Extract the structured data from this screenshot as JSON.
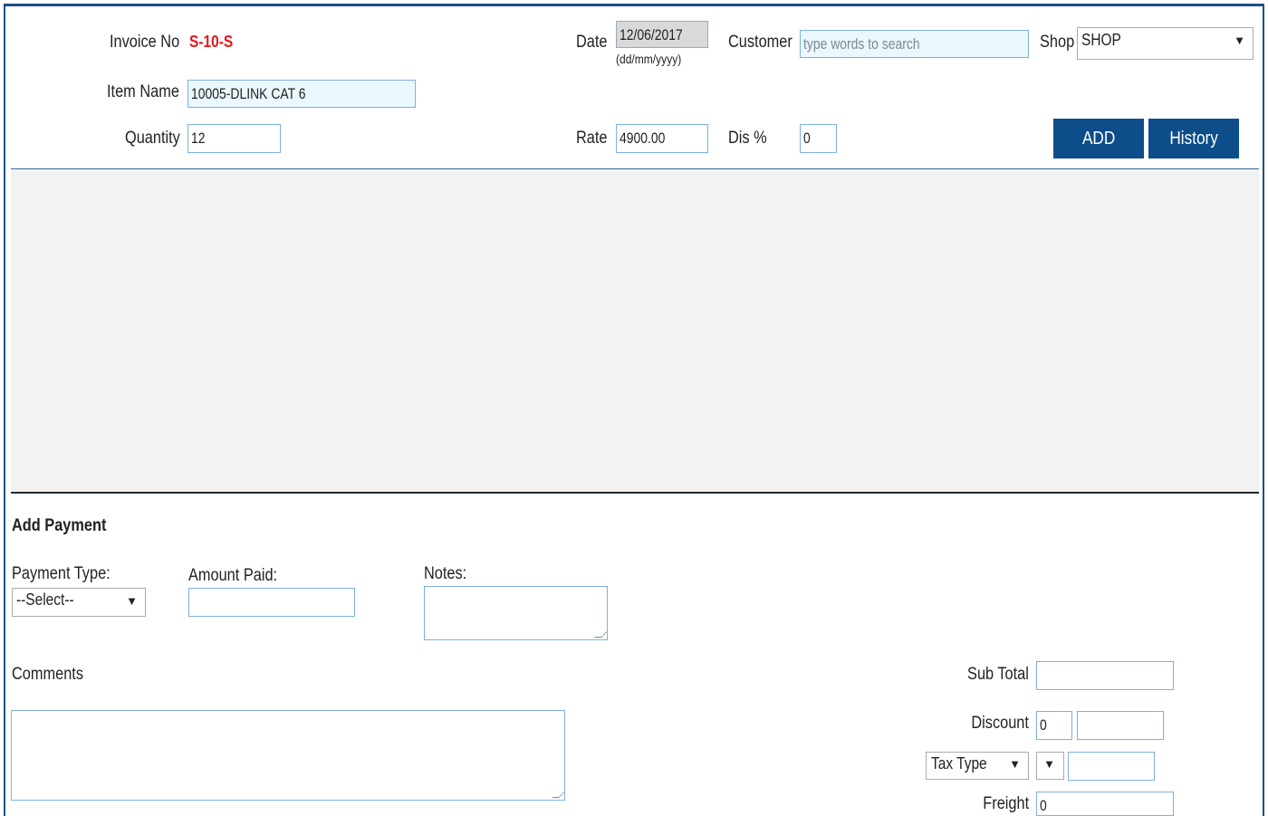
{
  "header": {
    "invoice_label": "Invoice No",
    "invoice_value": "S-10-S",
    "date_label": "Date",
    "date_value": "12/06/2017",
    "date_hint": "(dd/mm/yyyy)",
    "customer_label": "Customer",
    "customer_placeholder": "type words to search",
    "shop_label": "Shop",
    "shop_value": "SHOP",
    "item_label": "Item Name",
    "item_value": "10005-DLINK CAT 6",
    "quantity_label": "Quantity",
    "quantity_value": "12",
    "rate_label": "Rate",
    "rate_value": "4900.00",
    "dis_label": "Dis %",
    "dis_value": "0",
    "add_button": "ADD",
    "history_button": "History"
  },
  "payment": {
    "section_title": "Add Payment",
    "payment_type_label": "Payment Type:",
    "payment_type_value": "--Select--",
    "amount_paid_label": "Amount Paid:",
    "amount_paid_value": "",
    "notes_label": "Notes:",
    "comments_label": "Comments"
  },
  "totals": {
    "sub_total_label": "Sub Total",
    "sub_total_value": "",
    "discount_label": "Discount",
    "discount_value": "0",
    "discount_amount": "",
    "tax_type_value": "Tax Type",
    "tax_value": "",
    "freight_label": "Freight",
    "freight_value": "0"
  },
  "colors": {
    "invoice_red": "#e8161c",
    "button_blue": "#0d4d8a",
    "border_blue": "#1d4f8a"
  }
}
